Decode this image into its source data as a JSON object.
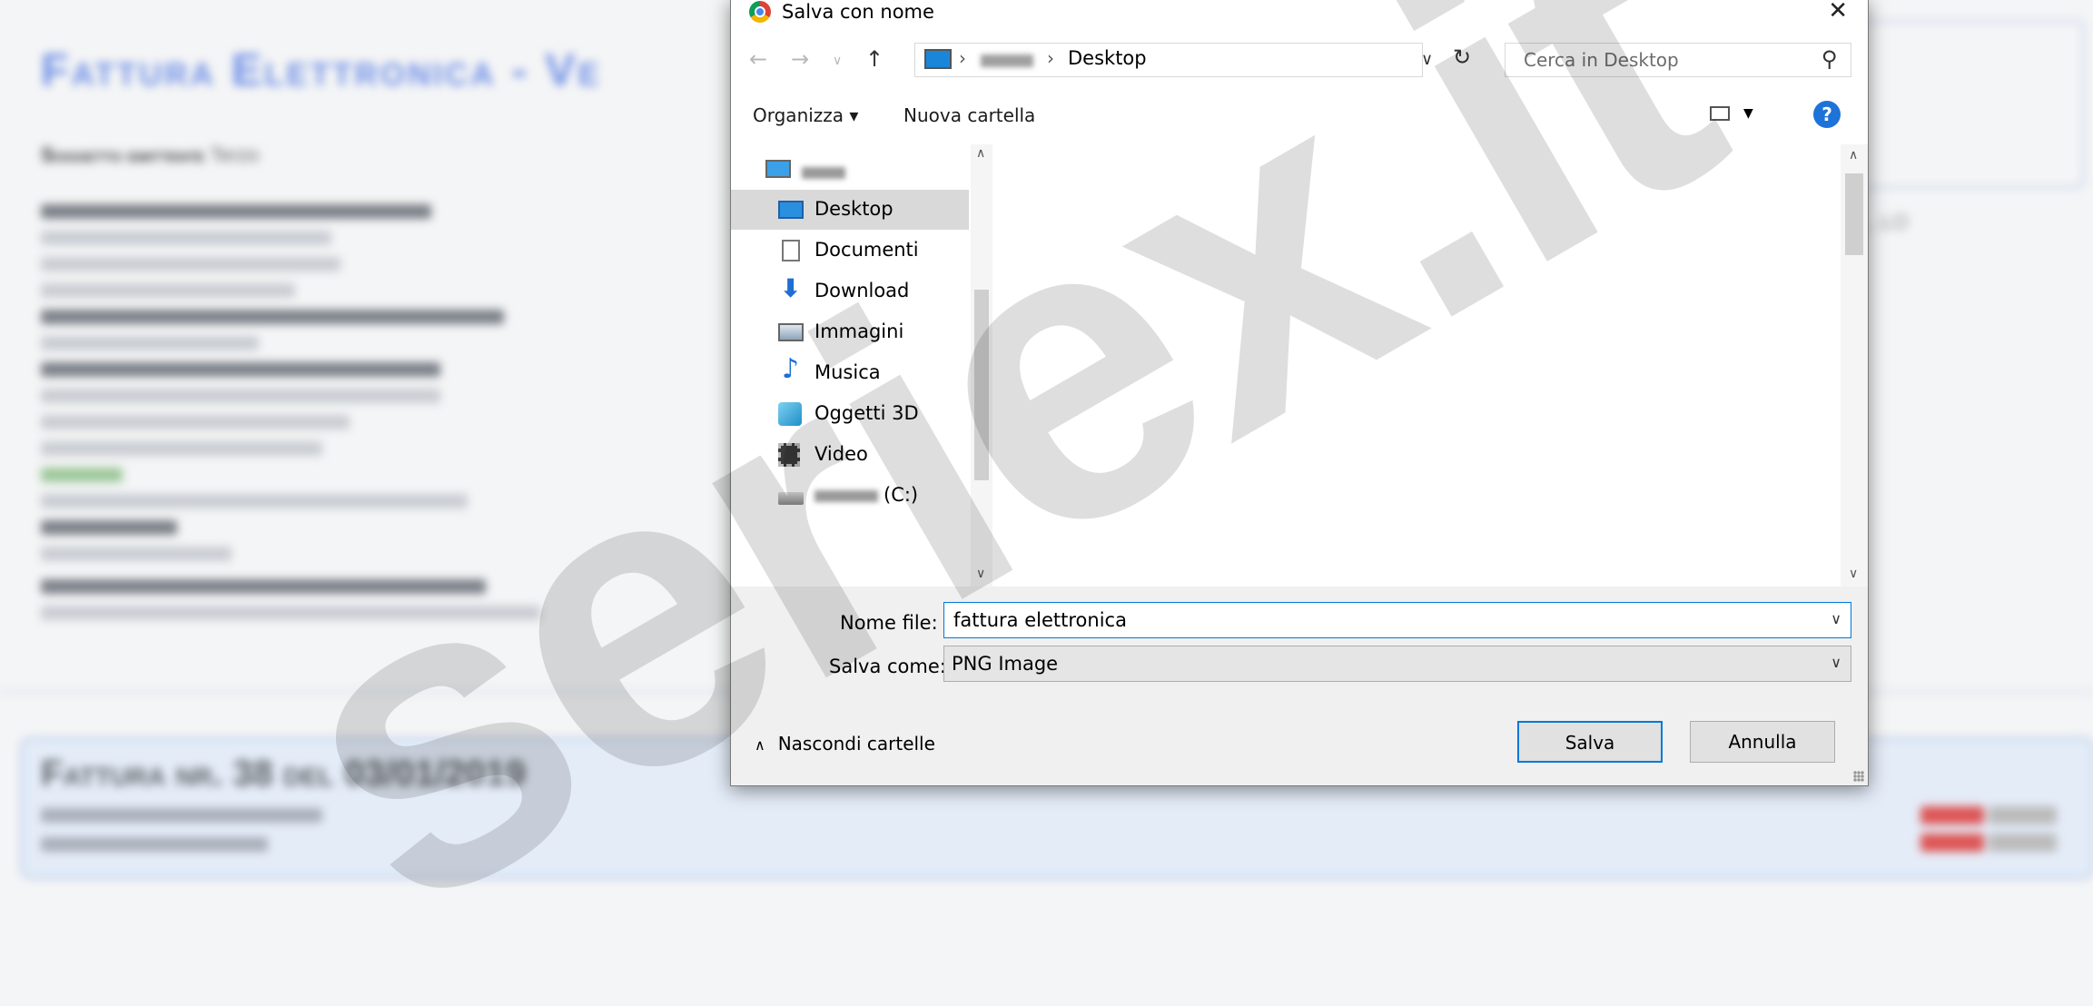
{
  "dialog": {
    "title": "Salva con nome",
    "path": {
      "current": "Desktop"
    },
    "search": {
      "placeholder": "Cerca in Desktop"
    },
    "toolbar": {
      "organize": "Organizza ▾",
      "new_folder": "Nuova cartella",
      "help": "?"
    },
    "nav_items": [
      {
        "label": "Desktop",
        "icon": "desktop-folder-icon",
        "selected": true
      },
      {
        "label": "Documenti",
        "icon": "documents-icon"
      },
      {
        "label": "Download",
        "icon": "download-icon"
      },
      {
        "label": "Immagini",
        "icon": "images-icon"
      },
      {
        "label": "Musica",
        "icon": "music-icon"
      },
      {
        "label": "Oggetti 3D",
        "icon": "3d-objects-icon"
      },
      {
        "label": "Video",
        "icon": "video-icon"
      }
    ],
    "drive_suffix": "(C:)",
    "filename": {
      "label": "Nome file:",
      "value": "fattura elettronica"
    },
    "save_as": {
      "label": "Salva come:",
      "value": "PNG Image"
    },
    "hide_folders": "Nascondi cartelle",
    "buttons": {
      "save": "Salva",
      "cancel": "Annulla"
    }
  },
  "watermark": "seriex.it",
  "colors": {
    "accent": "#0078d7",
    "selection": "#d9d9d9",
    "title_blue": "#6f8fe6"
  }
}
